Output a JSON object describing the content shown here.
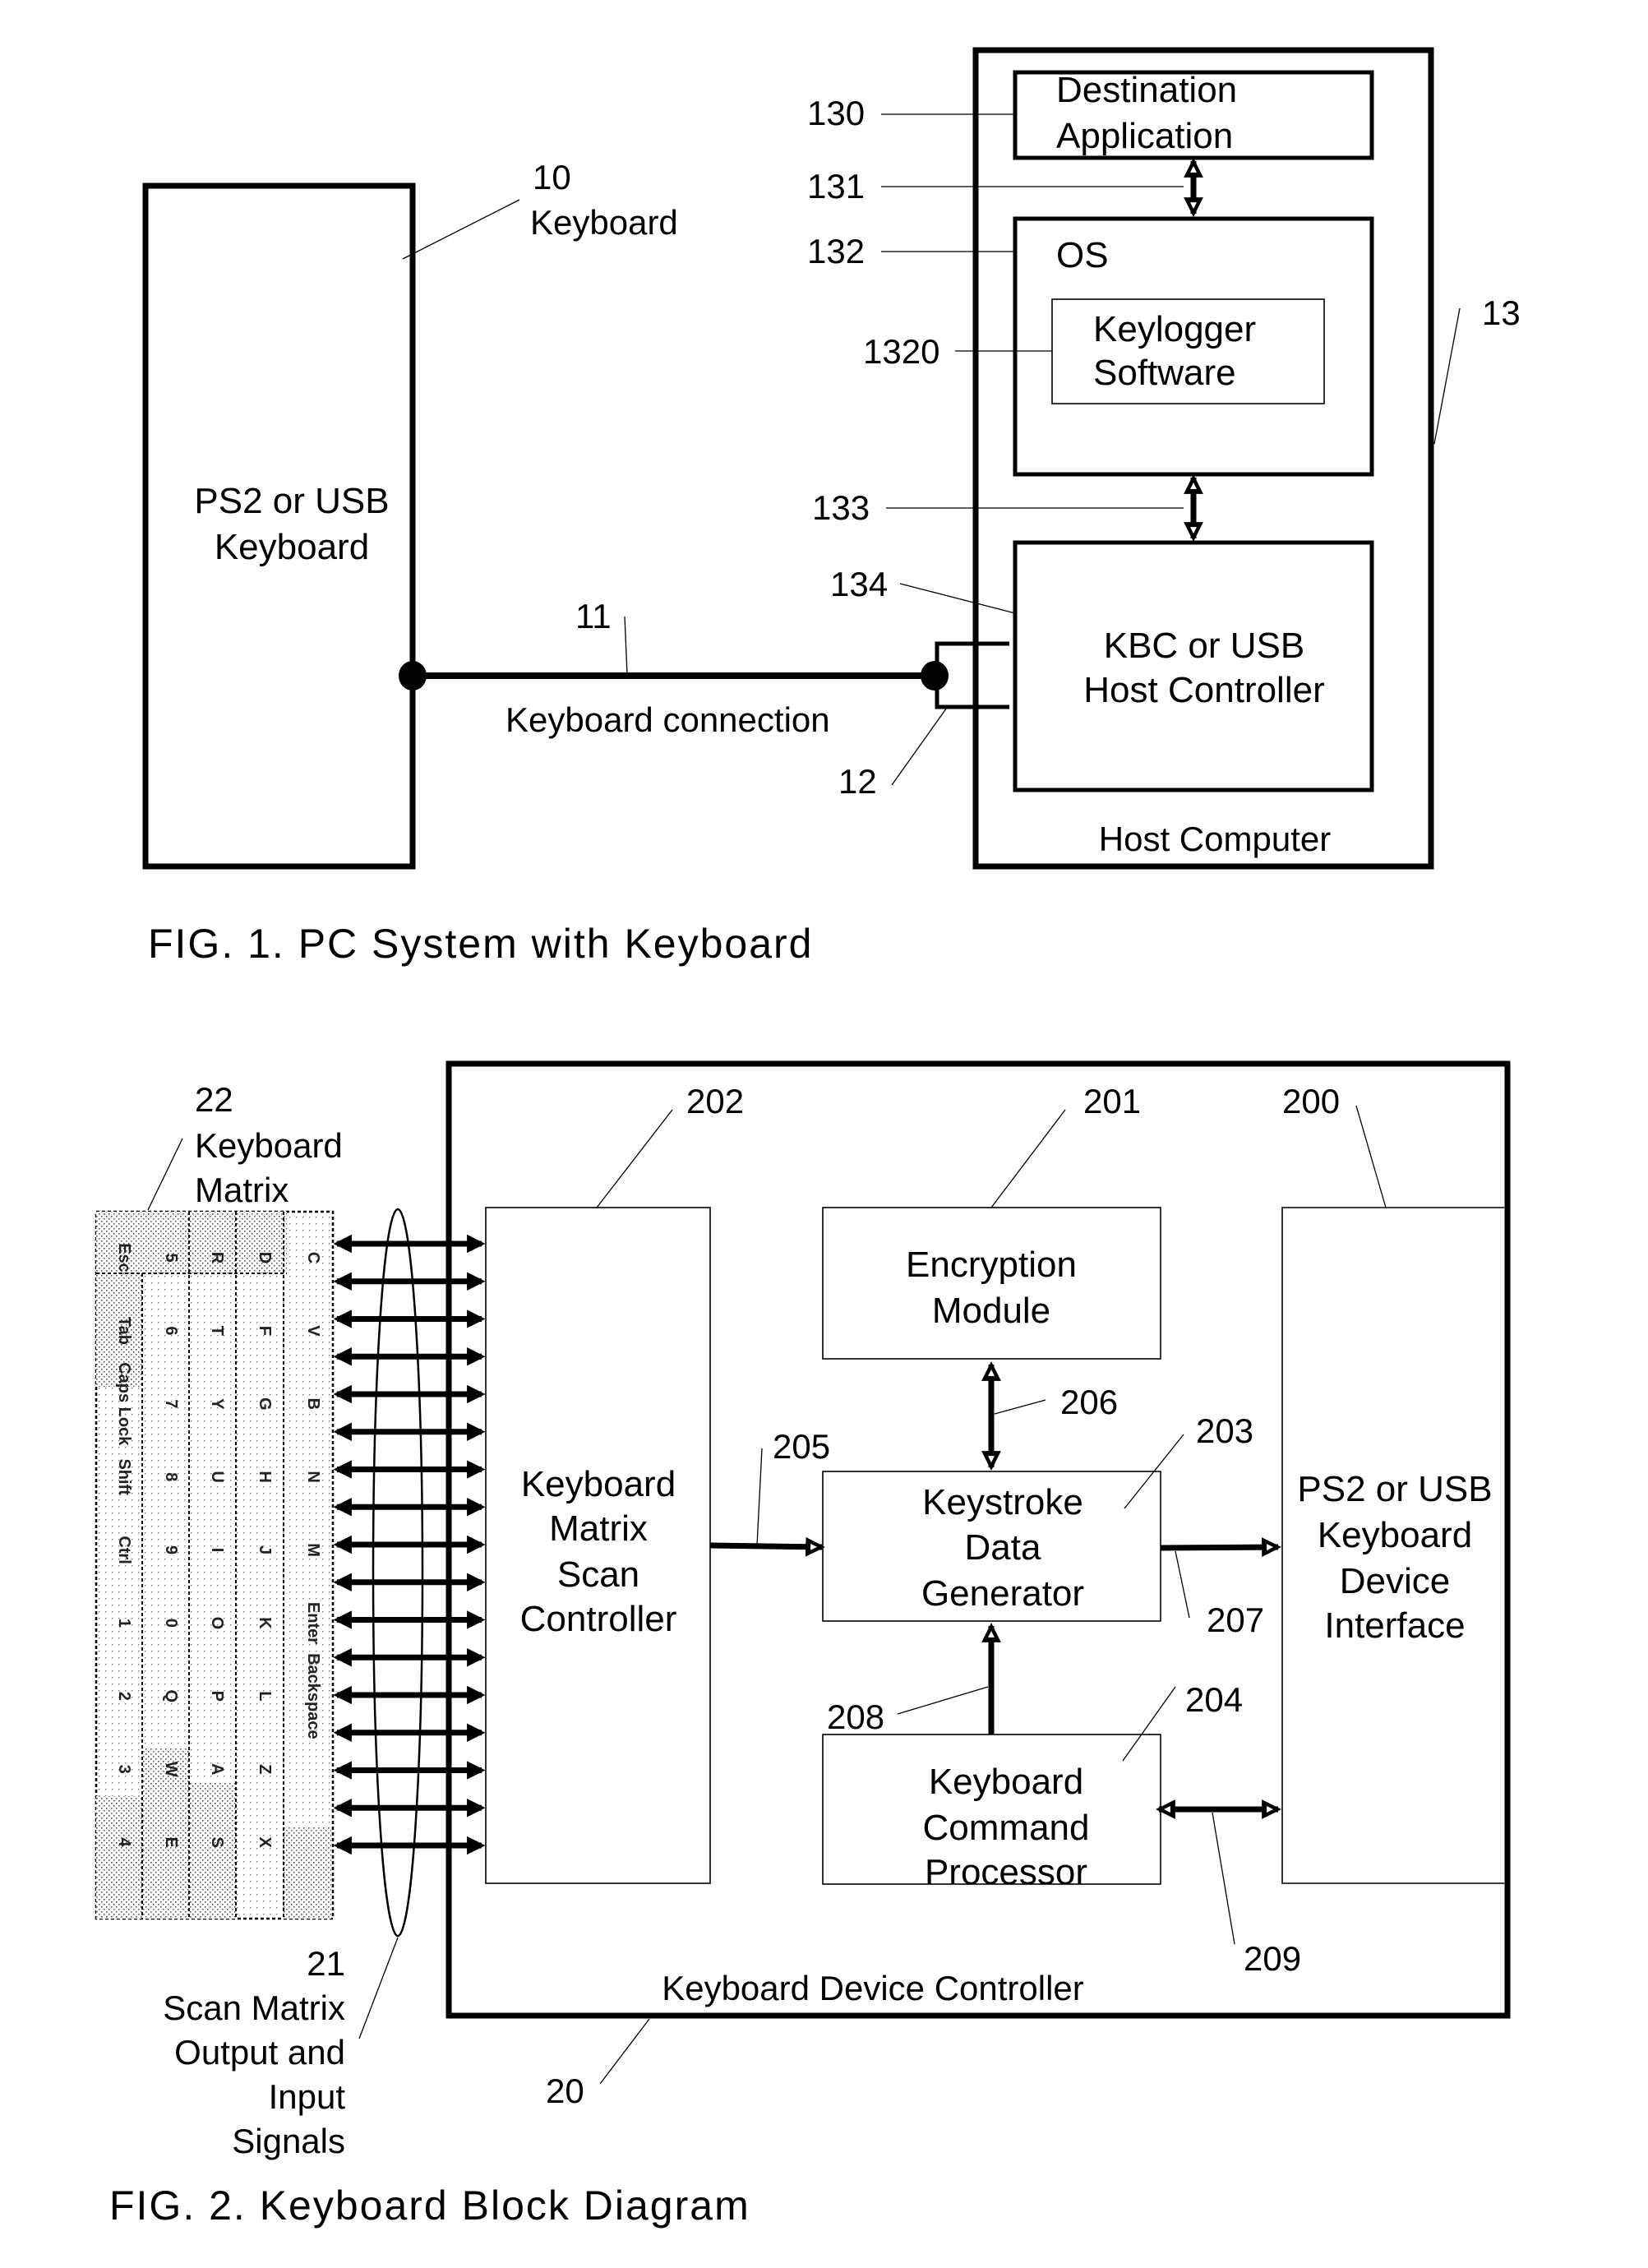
{
  "fig1": {
    "caption": "FIG. 1.  PC System with Keyboard",
    "keyboard_box": {
      "line1": "PS2 or USB",
      "line2": "Keyboard"
    },
    "ref_10": {
      "num": "10",
      "text": "Keyboard"
    },
    "ref_11": "11",
    "ref_12": "12",
    "ref_13": "13",
    "connection_label": "Keyboard connection",
    "host": {
      "label": "Host Computer",
      "dest_app": {
        "ref": "130",
        "line1": "Destination",
        "line2": "Application"
      },
      "ref_131": "131",
      "os": {
        "ref": "132",
        "label": "OS"
      },
      "keylogger": {
        "ref": "1320",
        "line1": "Keylogger",
        "line2": "Software"
      },
      "ref_133": "133",
      "kbc": {
        "ref": "134",
        "line1": "KBC  or USB",
        "line2": "Host Controller"
      }
    }
  },
  "fig2": {
    "caption": "FIG. 2.  Keyboard Block Diagram",
    "matrix": {
      "ref": "22",
      "line1": "Keyboard",
      "line2": "Matrix",
      "key_labels": [
        "Esc",
        "Tab",
        "Caps Lock",
        "Shift",
        "Ctrl",
        "1",
        "2",
        "3",
        "4",
        "5",
        "6",
        "7",
        "8",
        "9",
        "0",
        "Q",
        "W",
        "E",
        "R",
        "T",
        "Y",
        "U",
        "I",
        "O",
        "P",
        "A",
        "S",
        "D",
        "F",
        "G",
        "H",
        "J",
        "K",
        "L",
        "Z",
        "X",
        "C",
        "V",
        "B",
        "N",
        "M",
        "Enter",
        "Backspace"
      ]
    },
    "signals": {
      "ref": "21",
      "lines": [
        "Scan Matrix",
        "Output and",
        "Input",
        "Signals"
      ],
      "count": 17
    },
    "controller": {
      "ref": "20",
      "label": "Keyboard Device Controller"
    },
    "scan_controller": {
      "ref": "202",
      "lines": [
        "Keyboard",
        "Matrix",
        "Scan",
        "Controller"
      ]
    },
    "encryption": {
      "ref": "201",
      "lines": [
        "Encryption",
        "Module"
      ]
    },
    "keystroke": {
      "ref": "203",
      "lines": [
        "Keystroke",
        "Data",
        "Generator"
      ]
    },
    "command": {
      "ref": "204",
      "lines": [
        "Keyboard",
        "Command",
        "Processor"
      ]
    },
    "interface": {
      "ref": "200",
      "lines": [
        "PS2 or USB",
        "Keyboard",
        "Device",
        "Interface"
      ]
    },
    "ref_205": "205",
    "ref_206": "206",
    "ref_207": "207",
    "ref_208": "208",
    "ref_209": "209"
  }
}
